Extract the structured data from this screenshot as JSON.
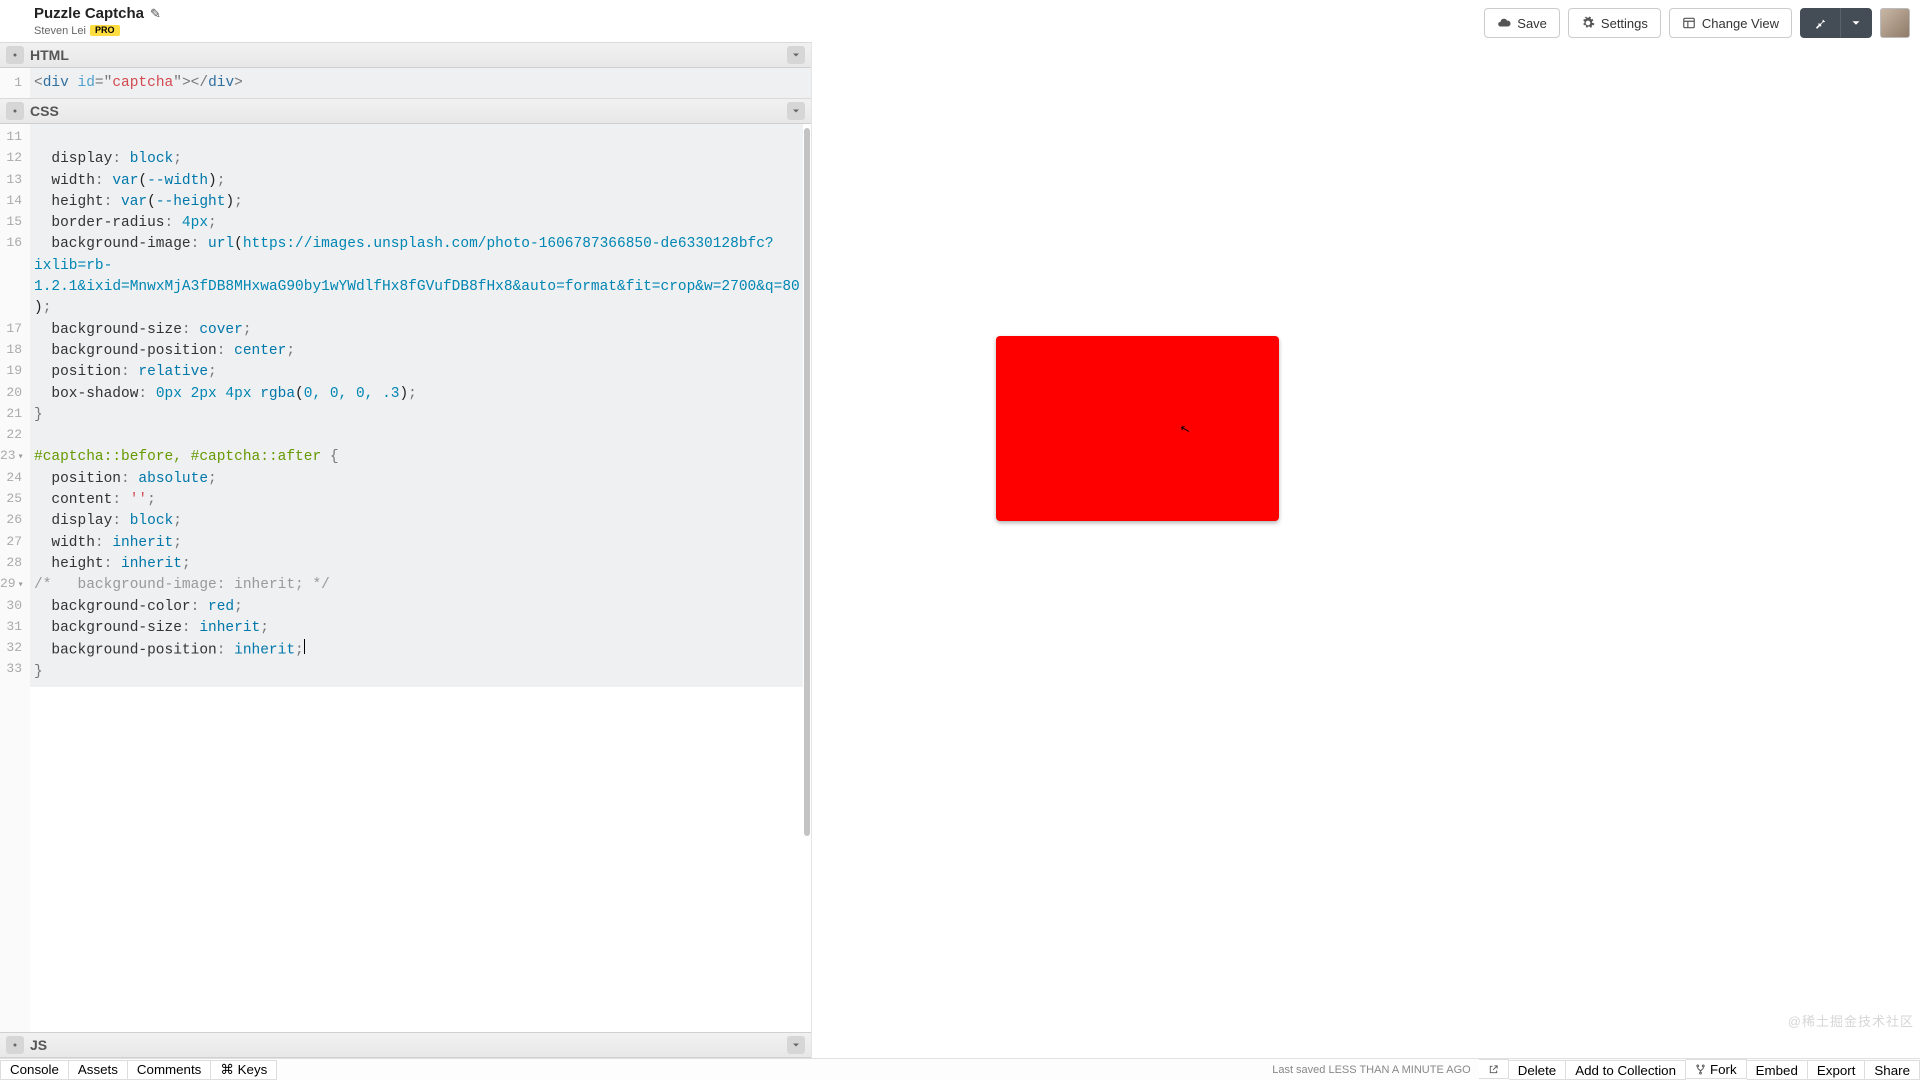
{
  "pen": {
    "title": "Puzzle Captcha",
    "author": "Steven Lei",
    "pro_label": "PRO"
  },
  "toolbar": {
    "save": "Save",
    "settings": "Settings",
    "change_view": "Change View"
  },
  "panels": {
    "html_label": "HTML",
    "css_label": "CSS",
    "js_label": "JS"
  },
  "html_code": {
    "line_numbers": [
      "1"
    ],
    "line1": {
      "open_lt": "<",
      "tag": "div",
      "attr": "id",
      "eq": "=",
      "q": "\"",
      "val": "captcha",
      "close1": ">",
      "open2_lt": "</",
      "tag2": "div",
      "close2": ">"
    }
  },
  "css_code": {
    "gutter": [
      "11",
      "12",
      "13",
      "14",
      "15",
      "16",
      "",
      "",
      "",
      "17",
      "18",
      "19",
      "20",
      "21",
      "22",
      "23",
      "24",
      "25",
      "26",
      "27",
      "28",
      "29",
      "30",
      "31",
      "32",
      "33"
    ],
    "fold_lines": [
      "23",
      "29"
    ],
    "l12": {
      "prop": "display",
      "val": "block"
    },
    "l13": {
      "prop": "width",
      "func": "var",
      "arg": "--width"
    },
    "l14": {
      "prop": "height",
      "func": "var",
      "arg": "--height"
    },
    "l15": {
      "prop": "border-radius",
      "num": "4px"
    },
    "l16": {
      "prop": "background-image",
      "func": "url",
      "url_a": "https://images.unsplash.com/photo-1606787366850-de6330128bfc?",
      "url_b": "ixlib=rb-",
      "url_c": "1.2.1&ixid=MnwxMjA3fDB8MHxwaG90by1wYWdlfHx8fGVufDB8fHx8&auto=format&fit=crop&w=2700&q=80"
    },
    "l17": {
      "prop": "background-size",
      "val": "cover"
    },
    "l18": {
      "prop": "background-position",
      "val": "center"
    },
    "l19": {
      "prop": "position",
      "val": "relative"
    },
    "l20": {
      "prop": "box-shadow",
      "raw_pre": "0px 2px 4px ",
      "func": "rgba",
      "args": "0, 0, 0, .3"
    },
    "l21": "}",
    "l23": {
      "sel": "#captcha::before, #captcha::after",
      "brace": "{"
    },
    "l24": {
      "prop": "position",
      "val": "absolute"
    },
    "l25": {
      "prop": "content",
      "val": "''"
    },
    "l26": {
      "prop": "display",
      "val": "block"
    },
    "l27": {
      "prop": "width",
      "val": "inherit"
    },
    "l28": {
      "prop": "height",
      "val": "inherit"
    },
    "l29": "/*   background-image: inherit; */",
    "l30": {
      "prop": "background-color",
      "val": "red"
    },
    "l31": {
      "prop": "background-size",
      "val": "inherit"
    },
    "l32": {
      "prop": "background-position",
      "val": "inherit",
      "cursor": true
    },
    "l33": "}"
  },
  "footer": {
    "left": [
      "Console",
      "Assets",
      "Comments",
      "Keys"
    ],
    "keys_glyph": "⌘",
    "status": "Last saved LESS THAN A MINUTE AGO",
    "right": [
      "Delete",
      "Add to Collection",
      "Fork",
      "Embed",
      "Export",
      "Share"
    ],
    "popout_title": "Open in new window"
  },
  "preview": {
    "color": "#ff0000"
  },
  "watermark": "@稀土掘金技术社区"
}
